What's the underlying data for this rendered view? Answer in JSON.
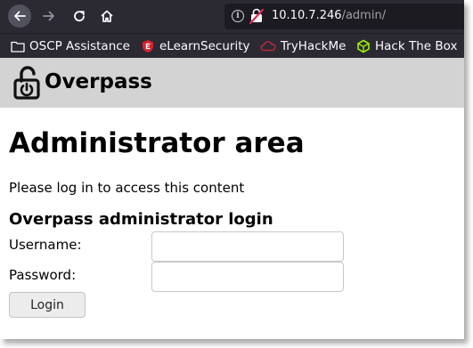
{
  "browser": {
    "url_host": "10.10.7.246",
    "url_path": "/admin/",
    "bookmarks": [
      {
        "label": "OSCP Assistance",
        "icon": "folder-icon"
      },
      {
        "label": "eLearnSecurity",
        "icon": "elearnsecurity-icon"
      },
      {
        "label": "TryHackMe",
        "icon": "tryhackme-icon"
      },
      {
        "label": "Hack The Box",
        "icon": "hackthebox-icon"
      }
    ]
  },
  "site": {
    "title": "Overpass"
  },
  "main": {
    "heading": "Administrator area",
    "intro": "Please log in to access this content",
    "form_heading": "Overpass administrator login",
    "username_label": "Username:",
    "username_value": "",
    "password_label": "Password:",
    "password_value": "",
    "login_label": "Login"
  },
  "colors": {
    "toolbar_bg": "#2b2a33",
    "urlbar_bg": "#1c1b22",
    "site_header_bg": "#d3d3d3",
    "insecure_lock": "#e22850",
    "htb_green": "#9fef00"
  }
}
